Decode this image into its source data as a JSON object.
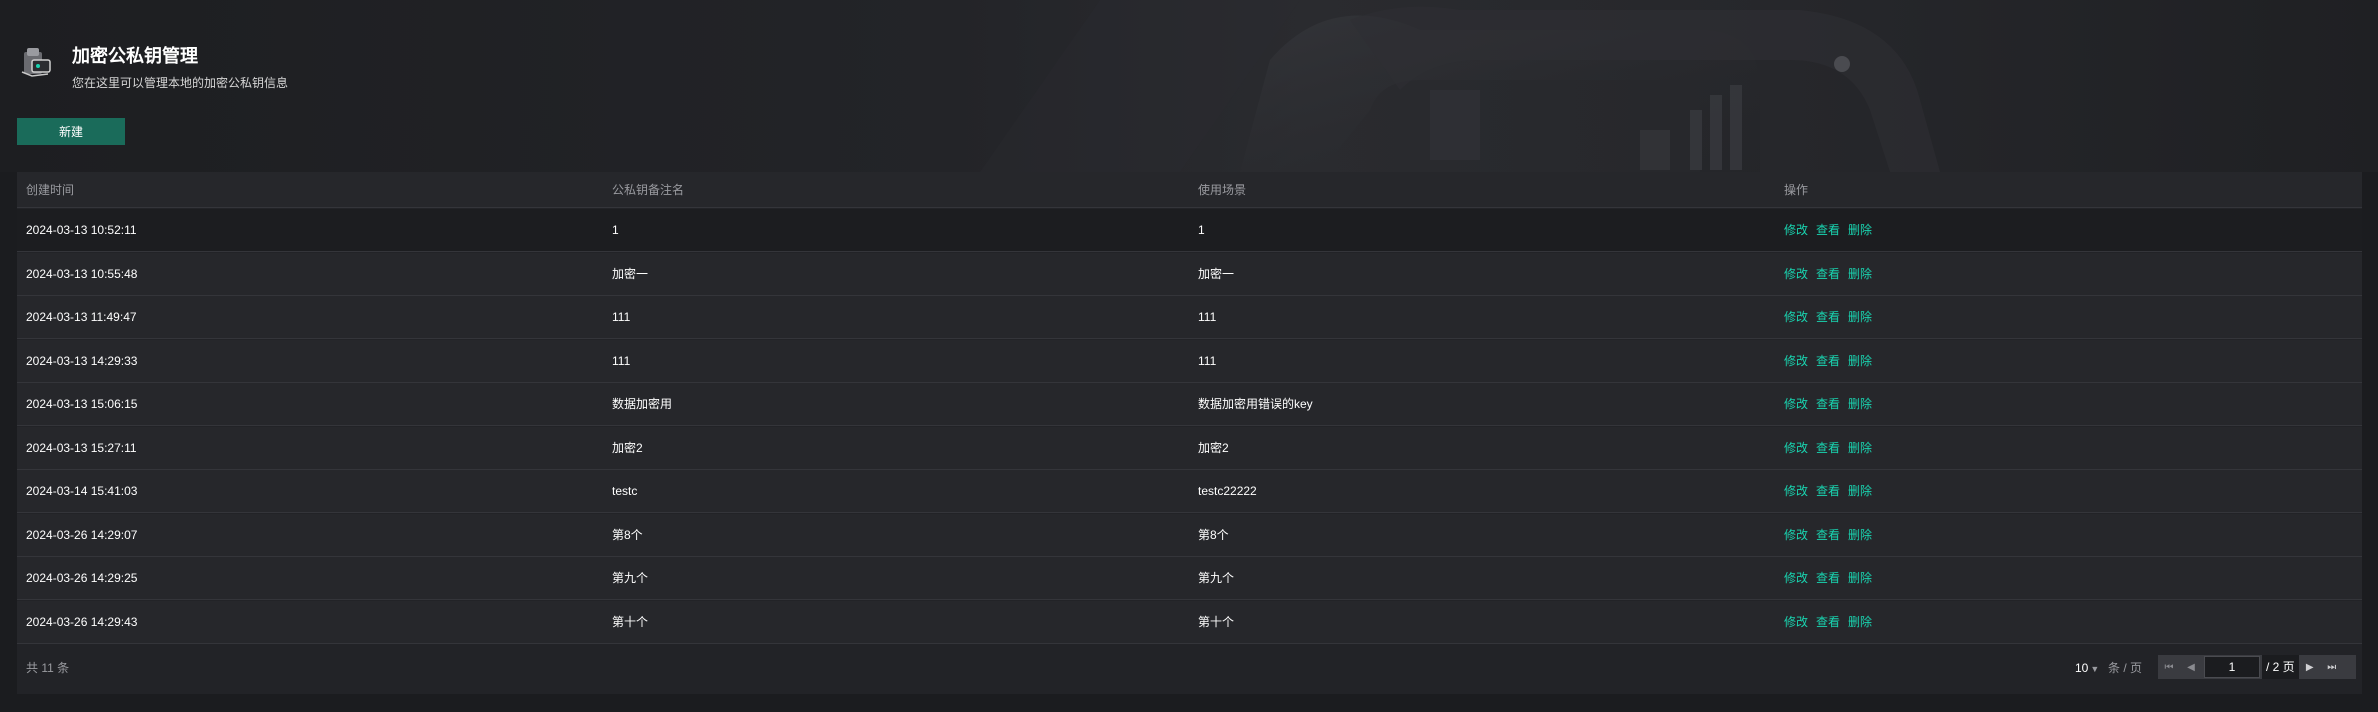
{
  "header": {
    "title": "加密公私钥管理",
    "subtitle": "您在这里可以管理本地的加密公私钥信息",
    "new_button": "新建"
  },
  "table": {
    "columns": [
      "创建时间",
      "公私钥备注名",
      "使用场景",
      "操作"
    ],
    "rows": [
      {
        "created": "2024-03-13 10:52:11",
        "name": "1",
        "scene": "1"
      },
      {
        "created": "2024-03-13 10:55:48",
        "name": "加密一",
        "scene": "加密一"
      },
      {
        "created": "2024-03-13 11:49:47",
        "name": "111",
        "scene": "111"
      },
      {
        "created": "2024-03-13 14:29:33",
        "name": "111",
        "scene": "111"
      },
      {
        "created": "2024-03-13 15:06:15",
        "name": "数据加密用",
        "scene": "数据加密用错误的key"
      },
      {
        "created": "2024-03-13 15:27:11",
        "name": "加密2",
        "scene": "加密2"
      },
      {
        "created": "2024-03-14 15:41:03",
        "name": "testc",
        "scene": "testc22222"
      },
      {
        "created": "2024-03-26 14:29:07",
        "name": "第8个",
        "scene": "第8个"
      },
      {
        "created": "2024-03-26 14:29:25",
        "name": "第九个",
        "scene": "第九个"
      },
      {
        "created": "2024-03-26 14:29:43",
        "name": "第十个",
        "scene": "第十个"
      }
    ],
    "actions": [
      "修改",
      "查看",
      "删除"
    ]
  },
  "pagination": {
    "total_text": "共  11  条",
    "page_size": "10",
    "page_size_unit": "条 / 页",
    "current_page": "1",
    "total_pages": "/ 2 页"
  },
  "colors": {
    "accent": "#19d4b0",
    "button_bg": "#1a6b5a"
  }
}
